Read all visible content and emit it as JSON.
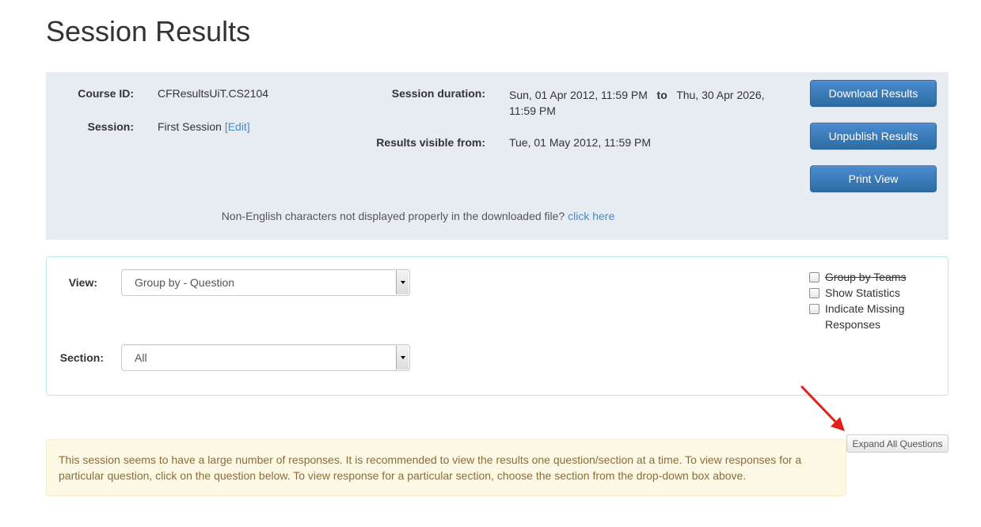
{
  "page": {
    "title": "Session Results"
  },
  "info": {
    "course_id_label": "Course ID:",
    "course_id_value": "CFResultsUiT.CS2104",
    "session_label": "Session:",
    "session_value": "First Session",
    "session_edit_link": "[Edit]",
    "duration_label": "Session duration:",
    "duration_start": "Sun, 01 Apr 2012, 11:59 PM",
    "duration_to": "to",
    "duration_end_line1": "Thu, 30 Apr 2026,",
    "duration_end_line2": "11:59 PM",
    "visible_label": "Results visible from:",
    "visible_value": "Tue, 01 May 2012, 11:59 PM",
    "encoding_note": "Non-English characters not displayed properly in the downloaded file?",
    "encoding_link": "click here"
  },
  "actions": {
    "download": "Download Results",
    "unpublish": "Unpublish Results",
    "print": "Print View"
  },
  "filters": {
    "view_label": "View:",
    "view_selected": "Group by - Question",
    "section_label": "Section:",
    "section_selected": "All",
    "checkboxes": [
      {
        "label": "Group by Teams",
        "checked": false,
        "strikethrough": true
      },
      {
        "label": "Show Statistics",
        "checked": false
      },
      {
        "label": "Indicate Missing",
        "checked": false
      },
      {
        "label": "Responses"
      }
    ]
  },
  "expand_button": "Expand All Questions",
  "alert": {
    "line1": "This session seems to have a large number of responses. It is recommended to view the results one question/section at a time. To view responses for a",
    "line2": "particular question, click on the question below. To view response for a particular section, choose the section from the drop-down box above."
  },
  "colors": {
    "primary": "#337ab7",
    "panel_bg": "#e7ecf3",
    "link": "#428bca",
    "alert_bg": "#fcf8e3",
    "alert_text": "#8a6d3b",
    "annotation_arrow": "#e0201b"
  }
}
